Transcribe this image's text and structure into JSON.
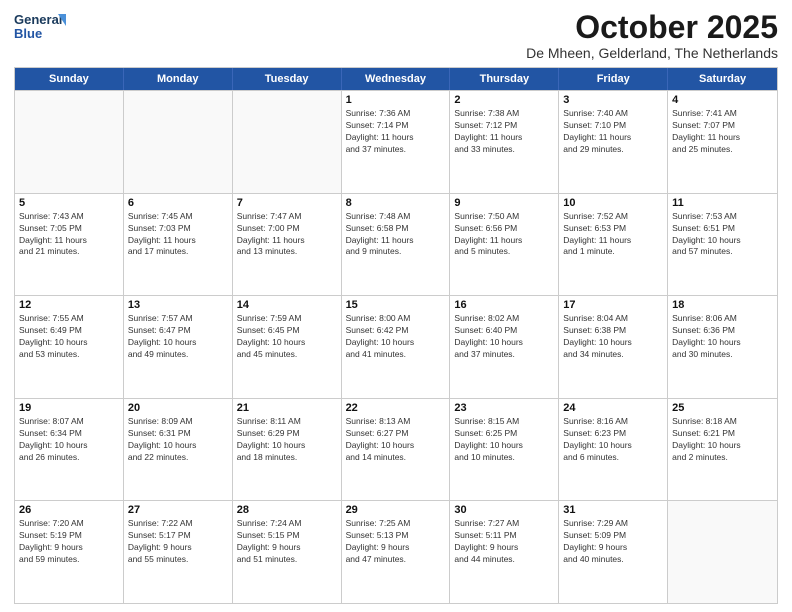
{
  "logo": {
    "line1": "General",
    "line2": "Blue"
  },
  "title": "October 2025",
  "subtitle": "De Mheen, Gelderland, The Netherlands",
  "days_of_week": [
    "Sunday",
    "Monday",
    "Tuesday",
    "Wednesday",
    "Thursday",
    "Friday",
    "Saturday"
  ],
  "weeks": [
    [
      {
        "day": "",
        "info": ""
      },
      {
        "day": "",
        "info": ""
      },
      {
        "day": "",
        "info": ""
      },
      {
        "day": "1",
        "info": "Sunrise: 7:36 AM\nSunset: 7:14 PM\nDaylight: 11 hours\nand 37 minutes."
      },
      {
        "day": "2",
        "info": "Sunrise: 7:38 AM\nSunset: 7:12 PM\nDaylight: 11 hours\nand 33 minutes."
      },
      {
        "day": "3",
        "info": "Sunrise: 7:40 AM\nSunset: 7:10 PM\nDaylight: 11 hours\nand 29 minutes."
      },
      {
        "day": "4",
        "info": "Sunrise: 7:41 AM\nSunset: 7:07 PM\nDaylight: 11 hours\nand 25 minutes."
      }
    ],
    [
      {
        "day": "5",
        "info": "Sunrise: 7:43 AM\nSunset: 7:05 PM\nDaylight: 11 hours\nand 21 minutes."
      },
      {
        "day": "6",
        "info": "Sunrise: 7:45 AM\nSunset: 7:03 PM\nDaylight: 11 hours\nand 17 minutes."
      },
      {
        "day": "7",
        "info": "Sunrise: 7:47 AM\nSunset: 7:00 PM\nDaylight: 11 hours\nand 13 minutes."
      },
      {
        "day": "8",
        "info": "Sunrise: 7:48 AM\nSunset: 6:58 PM\nDaylight: 11 hours\nand 9 minutes."
      },
      {
        "day": "9",
        "info": "Sunrise: 7:50 AM\nSunset: 6:56 PM\nDaylight: 11 hours\nand 5 minutes."
      },
      {
        "day": "10",
        "info": "Sunrise: 7:52 AM\nSunset: 6:53 PM\nDaylight: 11 hours\nand 1 minute."
      },
      {
        "day": "11",
        "info": "Sunrise: 7:53 AM\nSunset: 6:51 PM\nDaylight: 10 hours\nand 57 minutes."
      }
    ],
    [
      {
        "day": "12",
        "info": "Sunrise: 7:55 AM\nSunset: 6:49 PM\nDaylight: 10 hours\nand 53 minutes."
      },
      {
        "day": "13",
        "info": "Sunrise: 7:57 AM\nSunset: 6:47 PM\nDaylight: 10 hours\nand 49 minutes."
      },
      {
        "day": "14",
        "info": "Sunrise: 7:59 AM\nSunset: 6:45 PM\nDaylight: 10 hours\nand 45 minutes."
      },
      {
        "day": "15",
        "info": "Sunrise: 8:00 AM\nSunset: 6:42 PM\nDaylight: 10 hours\nand 41 minutes."
      },
      {
        "day": "16",
        "info": "Sunrise: 8:02 AM\nSunset: 6:40 PM\nDaylight: 10 hours\nand 37 minutes."
      },
      {
        "day": "17",
        "info": "Sunrise: 8:04 AM\nSunset: 6:38 PM\nDaylight: 10 hours\nand 34 minutes."
      },
      {
        "day": "18",
        "info": "Sunrise: 8:06 AM\nSunset: 6:36 PM\nDaylight: 10 hours\nand 30 minutes."
      }
    ],
    [
      {
        "day": "19",
        "info": "Sunrise: 8:07 AM\nSunset: 6:34 PM\nDaylight: 10 hours\nand 26 minutes."
      },
      {
        "day": "20",
        "info": "Sunrise: 8:09 AM\nSunset: 6:31 PM\nDaylight: 10 hours\nand 22 minutes."
      },
      {
        "day": "21",
        "info": "Sunrise: 8:11 AM\nSunset: 6:29 PM\nDaylight: 10 hours\nand 18 minutes."
      },
      {
        "day": "22",
        "info": "Sunrise: 8:13 AM\nSunset: 6:27 PM\nDaylight: 10 hours\nand 14 minutes."
      },
      {
        "day": "23",
        "info": "Sunrise: 8:15 AM\nSunset: 6:25 PM\nDaylight: 10 hours\nand 10 minutes."
      },
      {
        "day": "24",
        "info": "Sunrise: 8:16 AM\nSunset: 6:23 PM\nDaylight: 10 hours\nand 6 minutes."
      },
      {
        "day": "25",
        "info": "Sunrise: 8:18 AM\nSunset: 6:21 PM\nDaylight: 10 hours\nand 2 minutes."
      }
    ],
    [
      {
        "day": "26",
        "info": "Sunrise: 7:20 AM\nSunset: 5:19 PM\nDaylight: 9 hours\nand 59 minutes."
      },
      {
        "day": "27",
        "info": "Sunrise: 7:22 AM\nSunset: 5:17 PM\nDaylight: 9 hours\nand 55 minutes."
      },
      {
        "day": "28",
        "info": "Sunrise: 7:24 AM\nSunset: 5:15 PM\nDaylight: 9 hours\nand 51 minutes."
      },
      {
        "day": "29",
        "info": "Sunrise: 7:25 AM\nSunset: 5:13 PM\nDaylight: 9 hours\nand 47 minutes."
      },
      {
        "day": "30",
        "info": "Sunrise: 7:27 AM\nSunset: 5:11 PM\nDaylight: 9 hours\nand 44 minutes."
      },
      {
        "day": "31",
        "info": "Sunrise: 7:29 AM\nSunset: 5:09 PM\nDaylight: 9 hours\nand 40 minutes."
      },
      {
        "day": "",
        "info": ""
      }
    ]
  ]
}
